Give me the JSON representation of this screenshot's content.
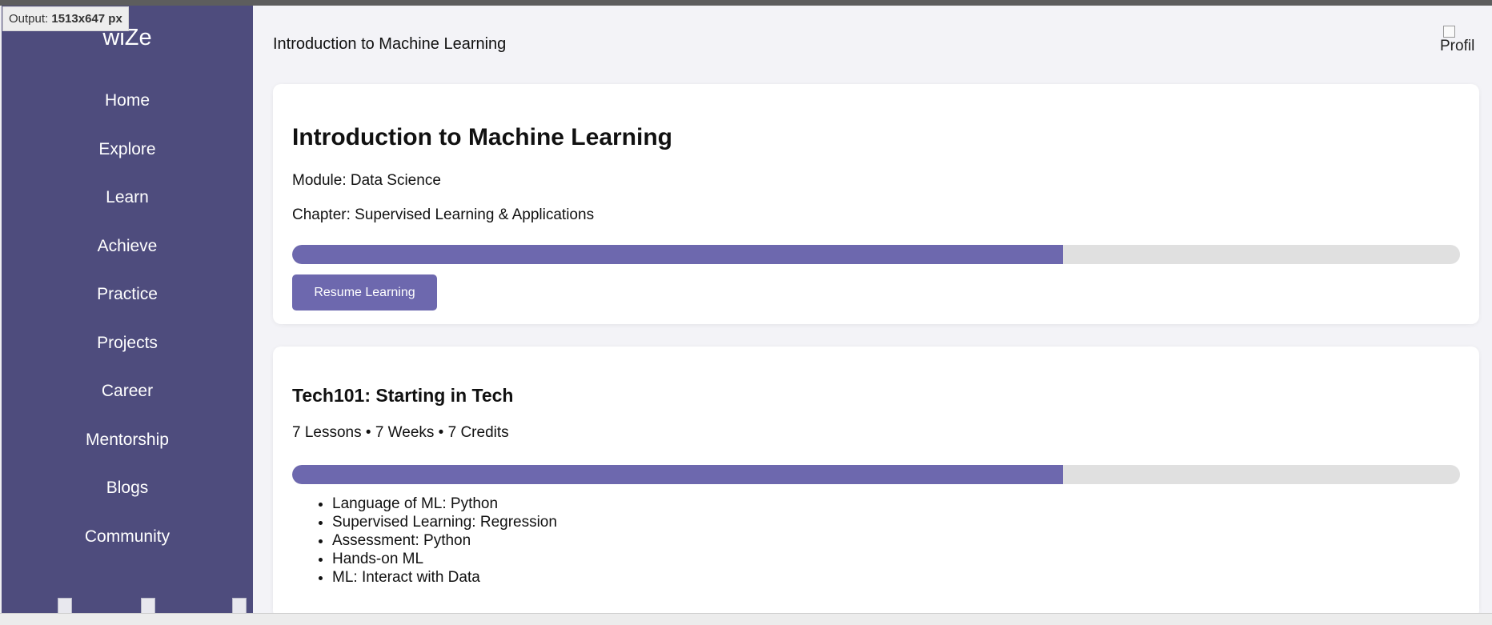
{
  "output_badge": {
    "label": "Output:",
    "value": "1513x647 px"
  },
  "brand": "wiZe",
  "nav": [
    "Home",
    "Explore",
    "Learn",
    "Achieve",
    "Practice",
    "Projects",
    "Career",
    "Mentorship",
    "Blogs",
    "Community"
  ],
  "header": {
    "title": "Introduction to Machine Learning",
    "profile_alt": "Profil"
  },
  "current_course": {
    "title": "Introduction to Machine Learning",
    "module": "Module: Data Science",
    "chapter": "Chapter: Supervised Learning & Applications",
    "progress": 0.66,
    "button": "Resume Learning"
  },
  "course2": {
    "title": "Tech101: Starting in Tech",
    "meta": "7 Lessons • 7 Weeks • 7 Credits",
    "progress": 0.66,
    "lessons": [
      "Language of ML: Python",
      "Supervised Learning: Regression",
      "Assessment: Python",
      "Hands-on ML",
      "ML: Interact with Data"
    ]
  },
  "colors": {
    "sidebar": "#4e4c7d",
    "accent": "#6d68ae",
    "track": "#e0e0e0"
  }
}
